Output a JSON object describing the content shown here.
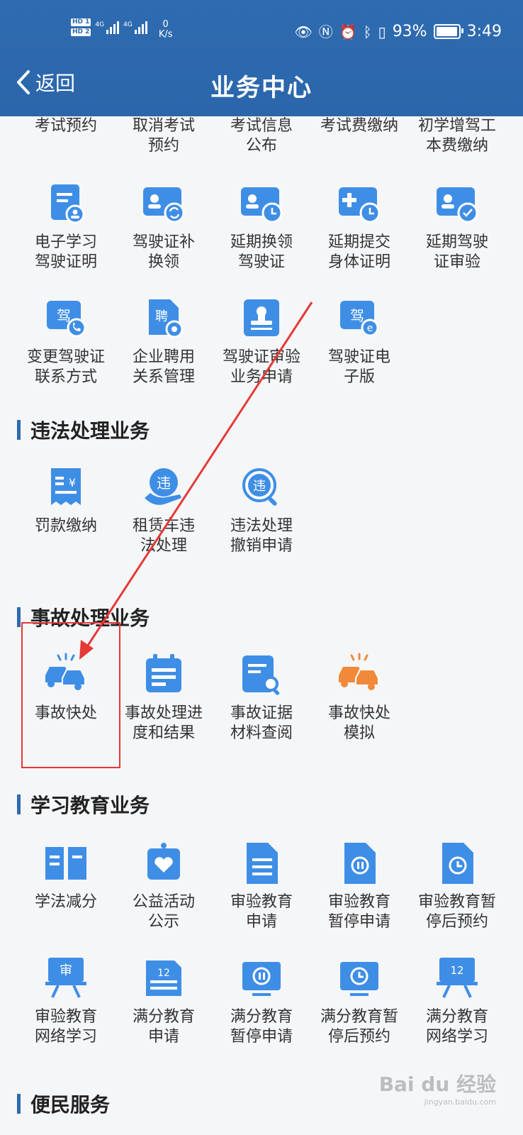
{
  "status_bar": {
    "hd1": "HD 1",
    "hd2": "HD 2",
    "net1": "4G",
    "net2": "4G",
    "speed_value": "0",
    "speed_unit": "K/s",
    "battery_pct": "93%",
    "time": "3:49"
  },
  "header": {
    "back_label": "返回",
    "title": "业务中心"
  },
  "colors": {
    "brand": "#2f6bb0",
    "icon_blue": "#3f8ee6",
    "icon_orange": "#f08a3a",
    "annotation_red": "#e53935"
  },
  "driver_license": {
    "top_row": [
      {
        "label": "考试预约"
      },
      {
        "label": "取消考试\n预约"
      },
      {
        "label": "考试信息\n公布"
      },
      {
        "label": "考试费缴纳"
      },
      {
        "label": "初学增驾工\n本费缴纳"
      }
    ],
    "items": [
      {
        "label": "电子学习\n驾驶证明",
        "icon": "doc-user-icon"
      },
      {
        "label": "驾驶证补\n换领",
        "icon": "card-swap-icon"
      },
      {
        "label": "延期换领\n驾驶证",
        "icon": "card-clock-icon"
      },
      {
        "label": "延期提交\n身体证明",
        "icon": "medical-clock-icon"
      },
      {
        "label": "延期驾驶\n证审验",
        "icon": "card-check-icon"
      },
      {
        "label": "变更驾驶证\n联系方式",
        "icon": "license-phone-icon"
      },
      {
        "label": "企业聘用\n关系管理",
        "icon": "hire-gear-icon"
      },
      {
        "label": "驾驶证审验\n业务申请",
        "icon": "stamp-icon"
      },
      {
        "label": "驾驶证电\n子版",
        "icon": "license-e-icon"
      }
    ]
  },
  "violation": {
    "title": "违法处理业务",
    "items": [
      {
        "label": "罚款缴纳",
        "icon": "receipt-yuan-icon"
      },
      {
        "label": "租赁车违\n法处理",
        "icon": "hand-violation-icon"
      },
      {
        "label": "违法处理\n撤销申请",
        "icon": "violation-search-icon"
      }
    ]
  },
  "accident": {
    "title": "事故处理业务",
    "items": [
      {
        "label": "事故快处",
        "icon": "car-crash-icon"
      },
      {
        "label": "事故处理进\n度和结果",
        "icon": "calendar-list-icon"
      },
      {
        "label": "事故证据\n材料查阅",
        "icon": "doc-search-icon"
      },
      {
        "label": "事故快处\n模拟",
        "icon": "car-crash-orange-icon"
      }
    ]
  },
  "education": {
    "title": "学习教育业务",
    "items": [
      {
        "label": "学法减分",
        "icon": "book-icon"
      },
      {
        "label": "公益活动\n公示",
        "icon": "heart-hand-icon"
      },
      {
        "label": "审验教育\n申请",
        "icon": "document-icon"
      },
      {
        "label": "审验教育\n暂停申请",
        "icon": "doc-pause-icon"
      },
      {
        "label": "审验教育暂\n停后预约",
        "icon": "doc-clock-icon"
      },
      {
        "label": "审验教育\n网络学习",
        "icon": "board-shen-icon"
      },
      {
        "label": "满分教育\n申请",
        "icon": "doc-12-icon"
      },
      {
        "label": "满分教育\n暂停申请",
        "icon": "pause-board-icon"
      },
      {
        "label": "满分教育暂\n停后预约",
        "icon": "clock-board-icon"
      },
      {
        "label": "满分教育\n网络学习",
        "icon": "board-12-icon"
      }
    ]
  },
  "convenience": {
    "title": "便民服务"
  },
  "watermark": {
    "brand": "Bai du 经验",
    "url": "jingyan.baidu.com"
  }
}
